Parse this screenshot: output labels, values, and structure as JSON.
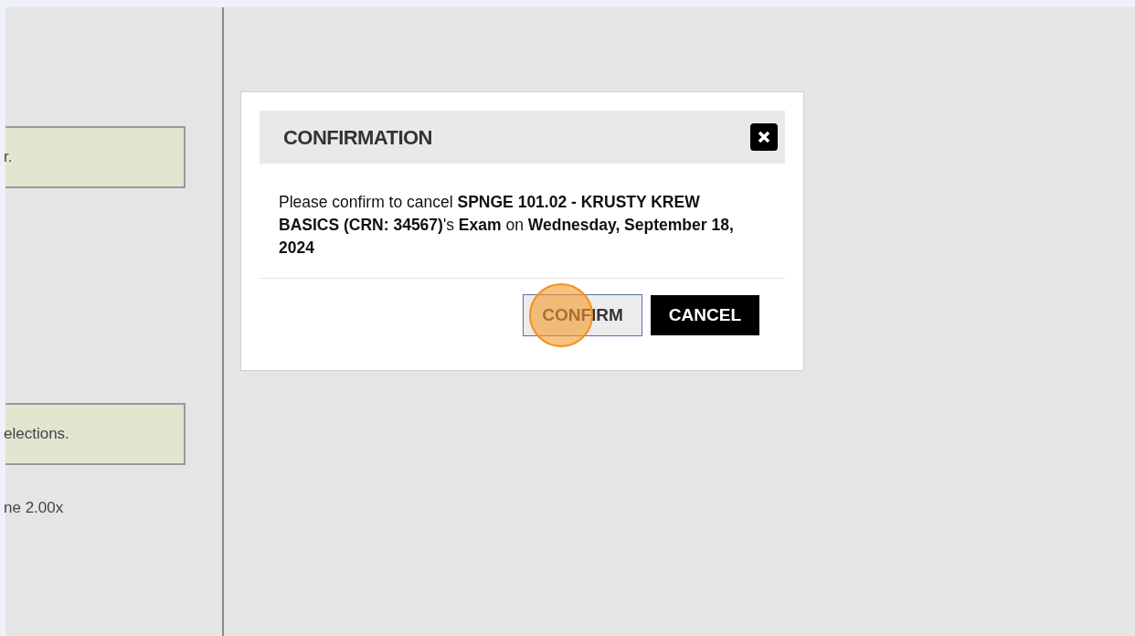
{
  "background": {
    "notices": [
      "r.",
      "elections."
    ],
    "note": "ne 2.00x"
  },
  "dialog": {
    "title": "CONFIRMATION",
    "message": "Please confirm to cancel **SPNGE 101.02 - KRUSTY KREW BASICS (CRN: 34567)**'s **Exam** on **Wednesday, September 18, 2024**",
    "buttons": [
      {
        "label": "CONFIRM",
        "kind": "secondary",
        "clicked": true
      },
      {
        "label": "CANCEL",
        "kind": "primary",
        "clicked": false
      }
    ]
  }
}
